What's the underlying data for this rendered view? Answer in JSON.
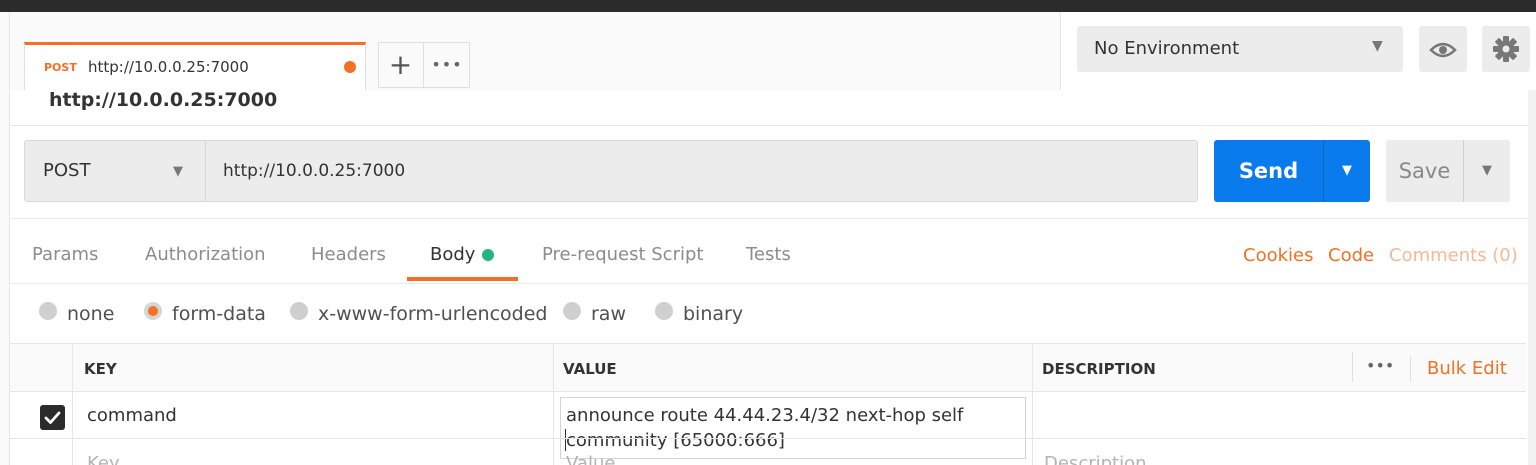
{
  "request_tab": {
    "method": "POST",
    "url": "http://10.0.0.25:7000",
    "unsaved_indicator_color": "#f47023"
  },
  "tab_actions": {
    "new_tab": "+",
    "more": "•••"
  },
  "request_title": "http://10.0.0.25:7000",
  "environment": {
    "selected": "No Environment"
  },
  "url_bar": {
    "method": "POST",
    "url": "http://10.0.0.25:7000"
  },
  "buttons": {
    "send": "Send",
    "save": "Save"
  },
  "request_tabs": [
    "Params",
    "Authorization",
    "Headers",
    "Body",
    "Pre-request Script",
    "Tests"
  ],
  "active_request_tab": "Body",
  "right_links": {
    "cookies": "Cookies",
    "code": "Code",
    "comments": "Comments (0)"
  },
  "body_types": [
    "none",
    "form-data",
    "x-www-form-urlencoded",
    "raw",
    "binary"
  ],
  "selected_body_type": "form-data",
  "table": {
    "headers": {
      "key": "KEY",
      "value": "VALUE",
      "description": "DESCRIPTION",
      "more": "•••",
      "bulk_edit": "Bulk Edit"
    },
    "rows": [
      {
        "checked": true,
        "key": "command",
        "value_line1": "announce route 44.44.23.4/32 next-hop self",
        "value_line2": "community [65000:666]",
        "description": ""
      }
    ],
    "placeholders": {
      "key": "Key",
      "value": "Value",
      "description": "Description"
    }
  },
  "colors": {
    "accent": "#f47023",
    "send": "#097bed",
    "body_dot": "#26b47f"
  }
}
